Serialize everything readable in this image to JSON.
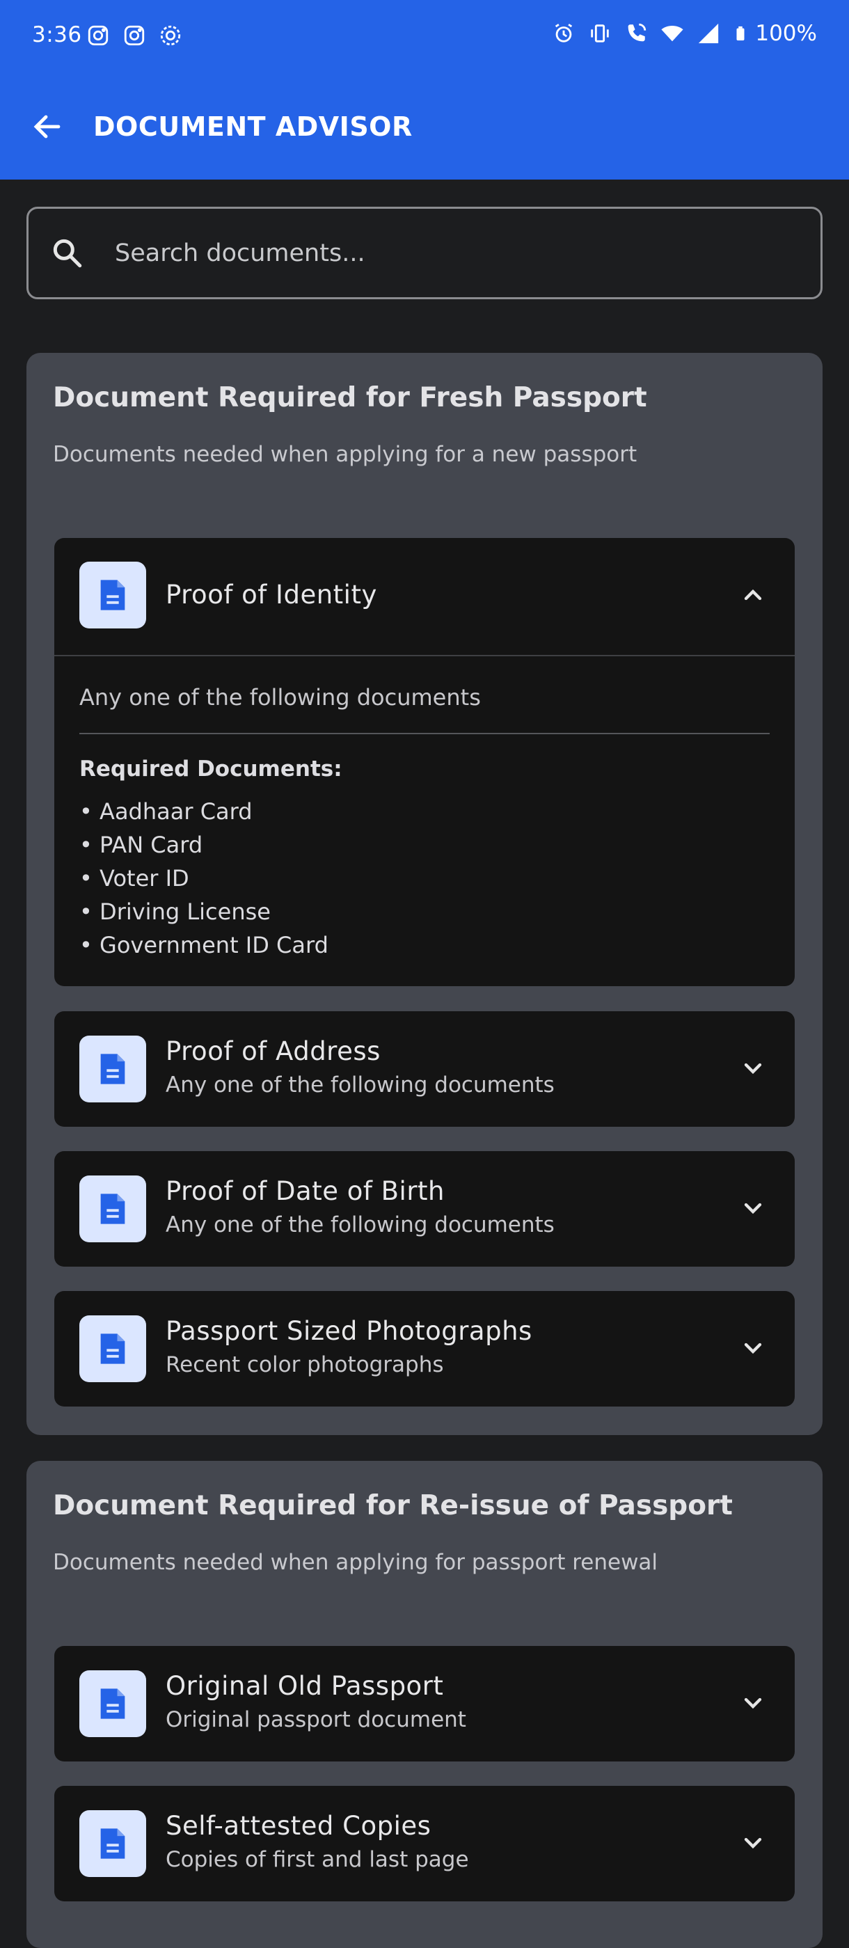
{
  "status_bar": {
    "time": "3:36",
    "battery": "100%",
    "left_icons": [
      "instagram-icon",
      "instagram-icon",
      "signal-app-icon"
    ],
    "right_icons": [
      "alarm-icon",
      "vibrate-icon",
      "wifi-calling-icon",
      "wifi-icon",
      "cell-signal-icon",
      "battery-icon"
    ]
  },
  "app_bar": {
    "title": "DOCUMENT ADVISOR",
    "back_icon": "arrow-left-icon"
  },
  "search": {
    "placeholder": "Search documents..."
  },
  "colors": {
    "primary": "#2563e7",
    "background": "#1c1d1f",
    "section_bg": "#44474f",
    "card_bg": "#141414",
    "icon_bg": "#dbe6ff"
  },
  "sections": [
    {
      "title": "Document Required for Fresh Passport",
      "subtitle": "Documents needed when applying for a new passport",
      "items": [
        {
          "title": "Proof of Identity",
          "subtitle": "",
          "expanded": true,
          "description": "Any one of the following documents",
          "required_label": "Required Documents:",
          "documents": [
            "• Aadhaar Card",
            "• PAN Card",
            "• Voter ID",
            "• Driving License",
            "• Government ID Card"
          ]
        },
        {
          "title": "Proof of Address",
          "subtitle": "Any one of the following documents",
          "expanded": false
        },
        {
          "title": "Proof of Date of Birth",
          "subtitle": "Any one of the following documents",
          "expanded": false
        },
        {
          "title": "Passport Sized Photographs",
          "subtitle": "Recent color photographs",
          "expanded": false
        }
      ]
    },
    {
      "title": "Document Required for Re-issue of Passport",
      "subtitle": "Documents needed when applying for passport renewal",
      "items": [
        {
          "title": "Original Old Passport",
          "subtitle": "Original passport document",
          "expanded": false
        },
        {
          "title": "Self-attested Copies",
          "subtitle": "Copies of first and last page",
          "expanded": false
        }
      ]
    }
  ]
}
